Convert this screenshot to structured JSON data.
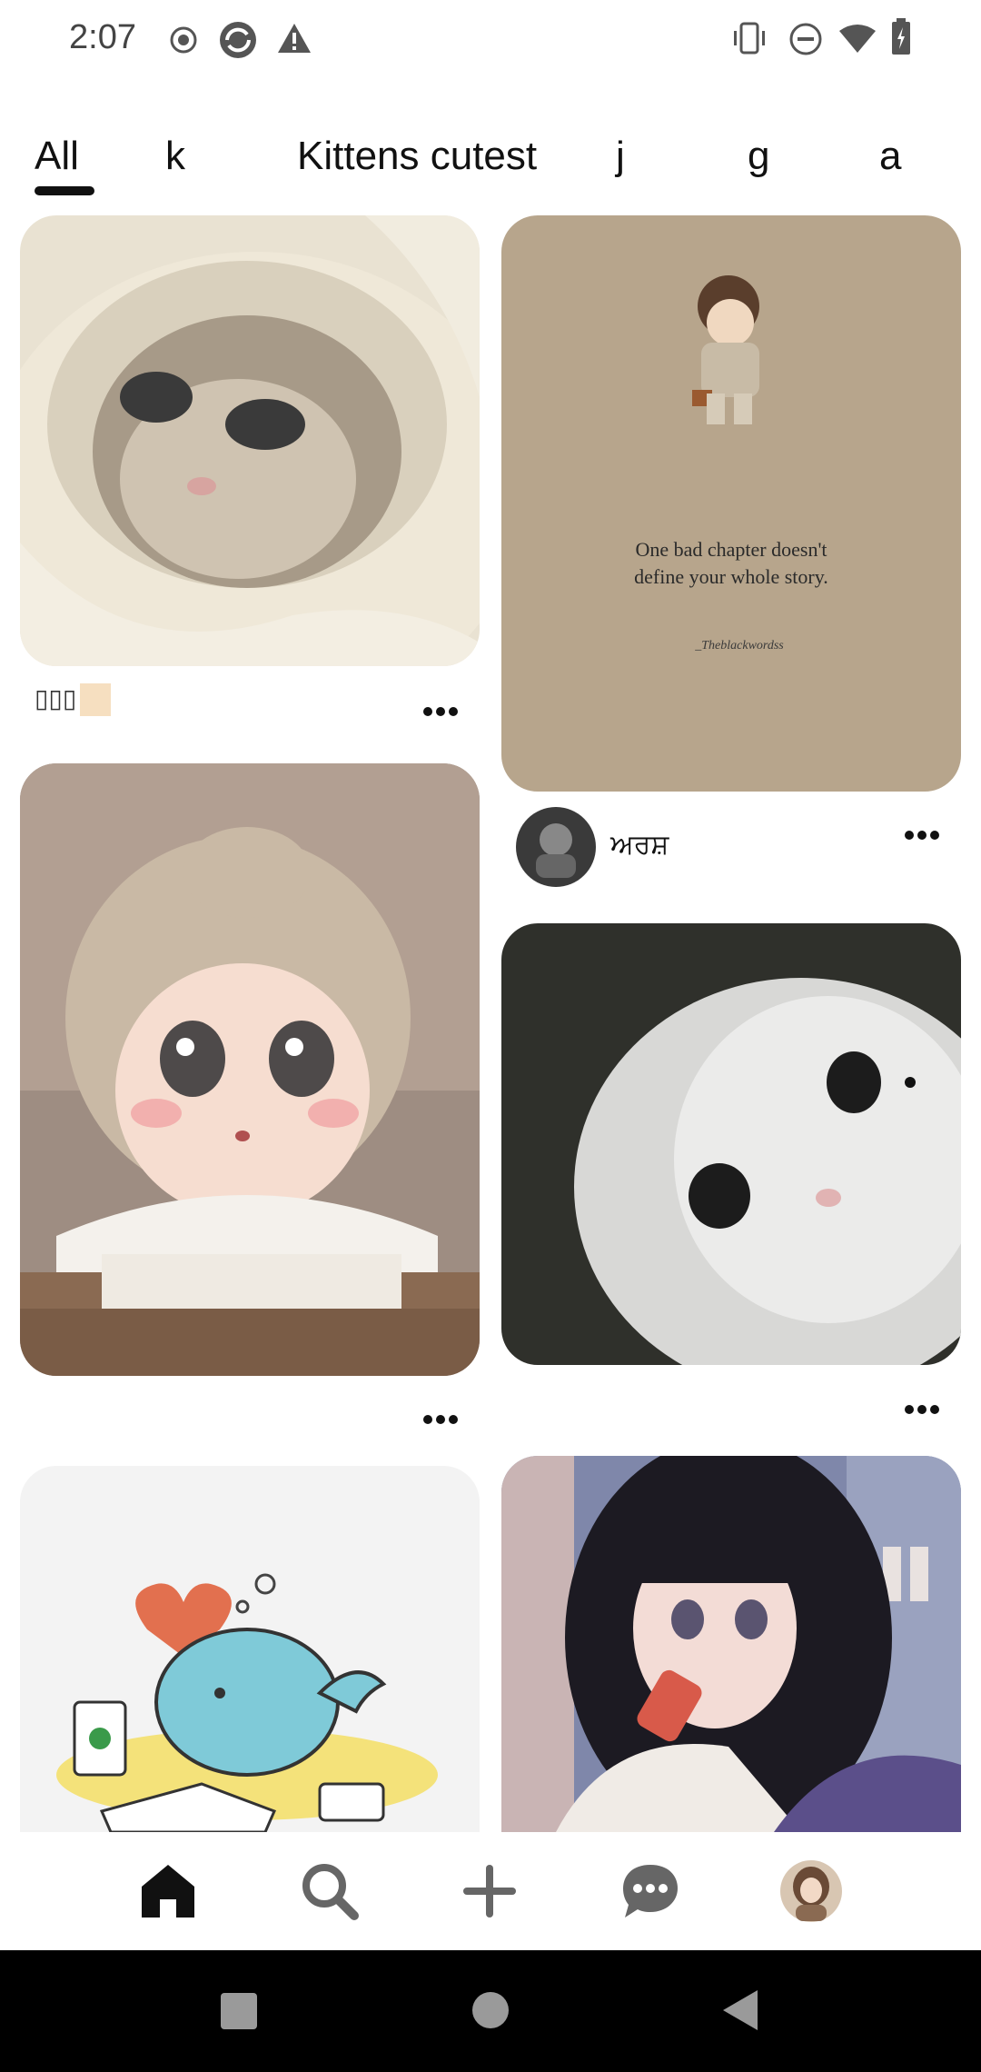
{
  "status_bar": {
    "time": "2:07"
  },
  "tabs": [
    {
      "label": "All",
      "selected": true
    },
    {
      "label": "k",
      "selected": false
    },
    {
      "label": "Kittens cutest",
      "selected": false
    },
    {
      "label": "j",
      "selected": false
    },
    {
      "label": "g",
      "selected": false
    },
    {
      "label": "a",
      "selected": false
    }
  ],
  "pins": {
    "pin1": {
      "caption": "▯▯▯"
    },
    "pin2": {
      "quote_line1": "One bad chapter doesn't",
      "quote_line2": "define your whole story.",
      "signature": "_Theblackwordss",
      "author": "ਅਰਸ਼"
    },
    "pin3": {},
    "pin4": {},
    "pin5": {},
    "pin6": {}
  },
  "bottom_nav": {
    "items": [
      "home-icon",
      "search-icon",
      "plus-icon",
      "chat-icon",
      "profile-avatar"
    ]
  },
  "colors": {
    "accent": "#111111",
    "background": "#ffffff"
  }
}
